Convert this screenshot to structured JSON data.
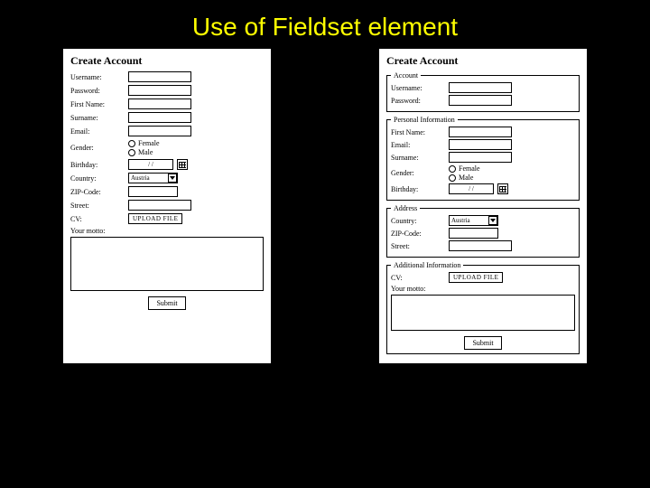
{
  "slide": {
    "title": "Use of Fieldset element"
  },
  "left": {
    "title": "Create Account",
    "labels": {
      "username": "Username:",
      "password": "Password:",
      "firstname": "First Name:",
      "surname": "Surname:",
      "email": "Email:",
      "gender": "Gender:",
      "female": "Female",
      "male": "Male",
      "birthday": "Birthday:",
      "date": "/  /",
      "country": "Country:",
      "country_val": "Austria",
      "zip": "ZIP-Code:",
      "street": "Street:",
      "cv": "CV:",
      "upload": "UPLOAD FILE",
      "motto": "Your motto:",
      "submit": "Submit"
    }
  },
  "right": {
    "title": "Create Account",
    "legends": {
      "account": "Account",
      "personal": "Personal Information",
      "address": "Address",
      "additional": "Additional Information"
    },
    "labels": {
      "username": "Username:",
      "password": "Password:",
      "firstname": "First Name:",
      "email": "Email:",
      "surname": "Surname:",
      "gender": "Gender:",
      "female": "Female",
      "male": "Male",
      "birthday": "Birthday:",
      "date": "/  /",
      "country": "Country:",
      "country_val": "Austria",
      "zip": "ZIP-Code:",
      "street": "Street:",
      "cv": "CV:",
      "upload": "UPLOAD FILE",
      "motto": "Your motto:",
      "submit": "Submit"
    }
  }
}
